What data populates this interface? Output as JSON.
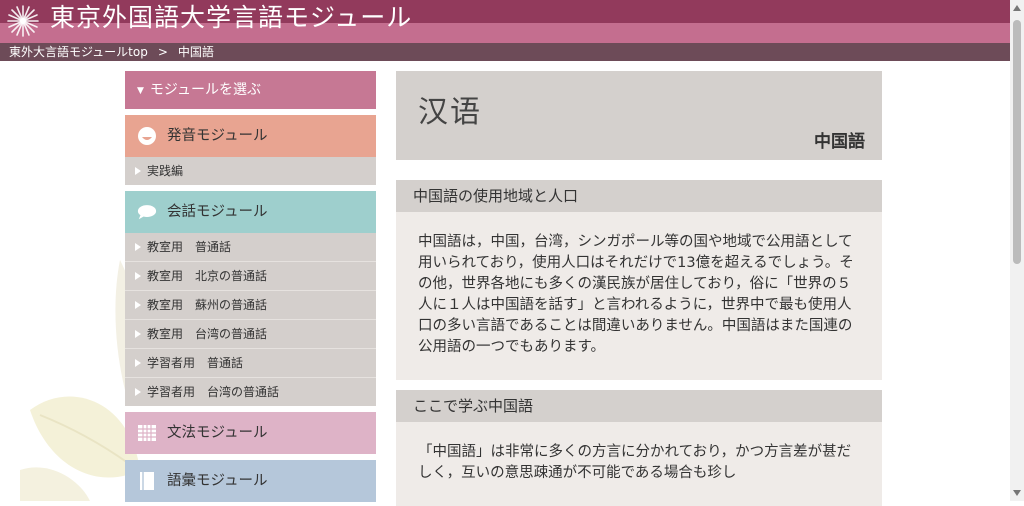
{
  "header": {
    "site_title": "東京外国語大学言語モジュール",
    "logo_icon": "star-burst-icon"
  },
  "breadcrumb": {
    "home": "東外大言語モジュールtop",
    "separator": ">",
    "current": "中国語"
  },
  "sidebar": {
    "heading": "モジュールを選ぶ",
    "modules": {
      "pronunciation": {
        "label": "発音モジュール",
        "icon": "face-icon",
        "items": [
          "実践編"
        ]
      },
      "conversation": {
        "label": "会話モジュール",
        "icon": "speech-bubble-icon",
        "items": [
          "教室用　普通話",
          "教室用　北京の普通話",
          "教室用　蘇州の普通話",
          "教室用　台湾の普通話",
          "学習者用　普通話",
          "学習者用　台湾の普通話"
        ]
      },
      "grammar": {
        "label": "文法モジュール",
        "icon": "grid-icon"
      },
      "vocabulary": {
        "label": "語彙モジュール",
        "icon": "book-icon"
      }
    }
  },
  "main": {
    "title_native": "汉语",
    "title_ja": "中国語",
    "sections": [
      {
        "heading": "中国語の使用地域と人口",
        "body": "中国語は，中国，台湾，シンガポール等の国や地域で公用語として用いられており，使用人口はそれだけで13億を超えるでしょう。その他，世界各地にも多くの漢民族が居住しており，俗に「世界の５人に１人は中国語を話す」と言われるように，世界中で最も使用人口の多い言語であることは間違いありません。中国語はまた国連の公用語の一つでもあります。"
      },
      {
        "heading": "ここで学ぶ中国語",
        "body": "「中国語」は非常に多くの方言に分かれており，かつ方言差が甚だしく，互いの意思疎通が不可能である場合も珍し"
      }
    ]
  },
  "colors": {
    "header_dark": "#923a5c",
    "header_light": "#c46e8f",
    "breadcrumb_bg": "#6d4b58",
    "sidebar_head": "#c67894",
    "pronunciation": "#e8a491",
    "conversation": "#9ecfcd",
    "grammar": "#deb3c7",
    "vocabulary": "#b5c7da",
    "panel": "#d4d0cd",
    "panel_body": "#efebe8"
  }
}
